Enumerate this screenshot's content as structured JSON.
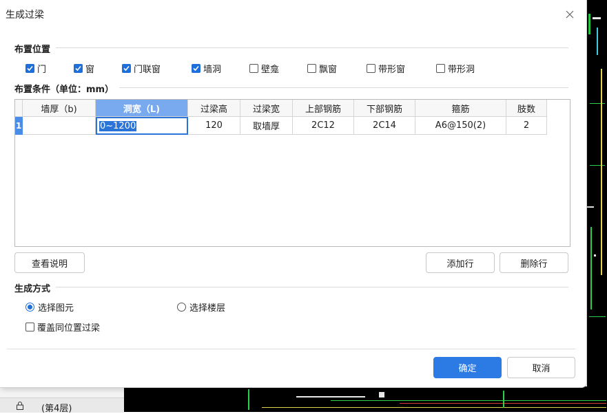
{
  "dialog": {
    "title": "生成过梁",
    "sections": {
      "placement": "布置位置",
      "condition": "布置条件（单位：mm）",
      "generate": "生成方式"
    },
    "placement_options": [
      {
        "label": "门",
        "checked": true
      },
      {
        "label": "窗",
        "checked": true
      },
      {
        "label": "门联窗",
        "checked": true
      },
      {
        "label": "墙洞",
        "checked": true
      },
      {
        "label": "壁龛",
        "checked": false
      },
      {
        "label": "飘窗",
        "checked": false
      },
      {
        "label": "带形窗",
        "checked": false
      },
      {
        "label": "带形洞",
        "checked": false
      }
    ],
    "table": {
      "columns": [
        "墙厚（b)",
        "洞宽（L)",
        "过梁高",
        "过梁宽",
        "上部钢筋",
        "下部钢筋",
        "箍筋",
        "肢数"
      ],
      "rows": [
        {
          "num": "1",
          "cells": [
            "",
            "0~1200",
            "120",
            "取墙厚",
            "2C12",
            "2C14",
            "A6@150(2)",
            "2"
          ]
        }
      ]
    },
    "buttons": {
      "view_help": "查看说明",
      "add_row": "添加行",
      "delete_row": "删除行",
      "ok": "确定",
      "cancel": "取消"
    },
    "generate_mode": {
      "select_element": "选择图元",
      "select_floor": "选择楼层",
      "selected": "select_element",
      "overwrite_label": "覆盖同位置过梁",
      "overwrite_checked": false
    }
  },
  "background": {
    "floor_label": "(第4层)"
  },
  "colors": {
    "accent": "#2c7be5",
    "check": "#1e6fd9",
    "header_selected": "#79aaf0"
  }
}
